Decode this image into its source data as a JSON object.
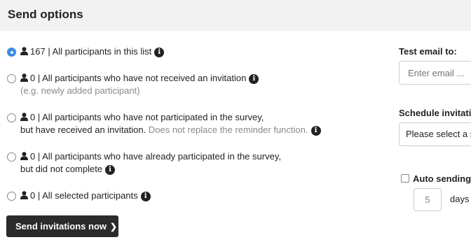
{
  "header": {
    "title": "Send options"
  },
  "options": [
    {
      "count": "167",
      "text": "| All participants in this list",
      "selected": true
    },
    {
      "count": "0",
      "text": "| All participants who have not received an invitation",
      "note": "(e.g. newly added participant)"
    },
    {
      "count": "0",
      "text": "| All participants who have not participated in the survey,",
      "line2": "but have received an invitation.",
      "line2_muted": "Does not replace the reminder function."
    },
    {
      "count": "0",
      "text": "| All participants who have already participated in the survey,",
      "line2": "but did not complete"
    },
    {
      "count": "0",
      "text": "| All selected participants"
    }
  ],
  "send_button": {
    "label": "Send invitations now",
    "icon": "chevron-right-icon"
  },
  "test_email": {
    "label": "Test email to:",
    "placeholder": "Enter email ..."
  },
  "schedule": {
    "label": "Schedule invitati",
    "select_value": "Please select a s"
  },
  "auto_sending": {
    "label": "Auto sending",
    "days_value": "5",
    "days_label": "days"
  },
  "colors": {
    "radio_selected": "#3b8de3",
    "button_bg": "#2b2b2b",
    "header_bg": "#f2f2f2"
  }
}
